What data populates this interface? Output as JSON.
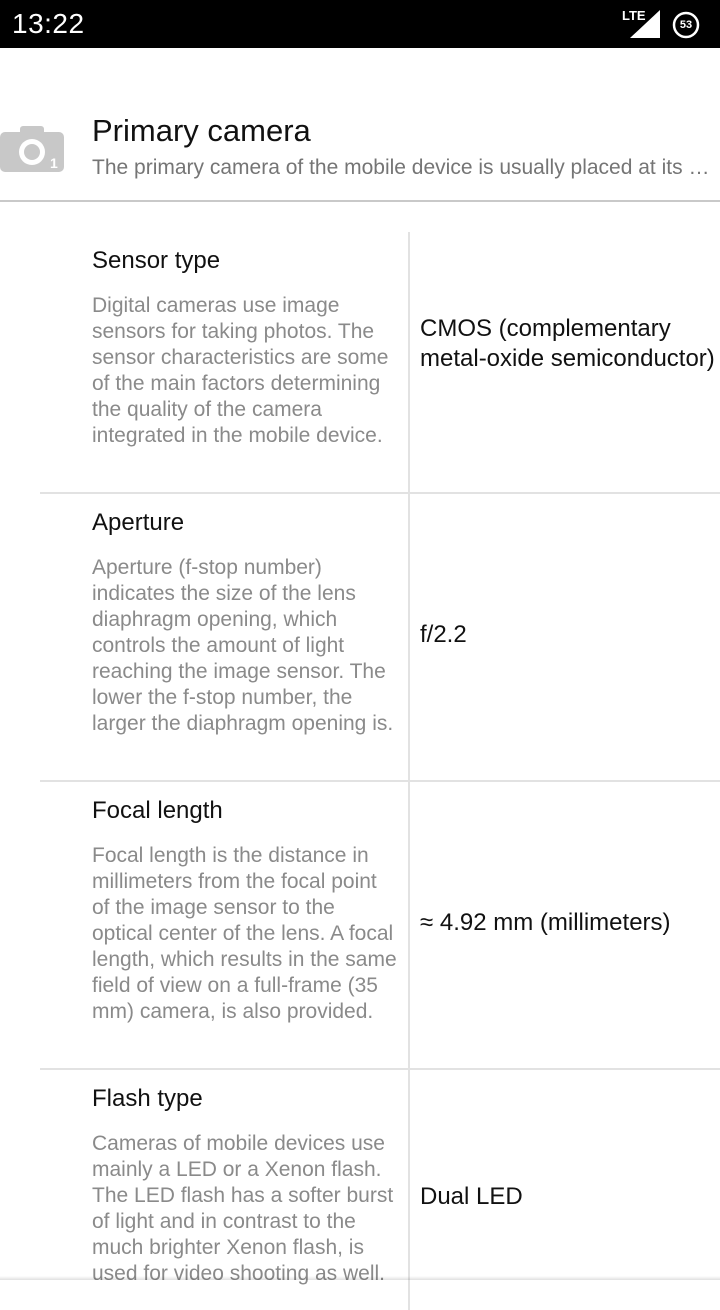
{
  "status_bar": {
    "time": "13:22",
    "network": "LTE",
    "battery": "53"
  },
  "section": {
    "icon": "camera-icon",
    "title": "Primary camera",
    "subtitle": "The primary camera of the mobile device is usually placed at its back and is used for photo and video recording."
  },
  "specs": [
    {
      "name": "Sensor type",
      "description": "Digital cameras use image sensors for taking photos. The sensor characteristics are some of the main factors determining the quality of the camera integrated in the mobile device.",
      "value": "CMOS (complementary metal-oxide semiconductor)"
    },
    {
      "name": "Aperture",
      "description": "Aperture (f-stop number) indicates the size of the lens diaphragm opening, which controls the amount of light reaching the image sensor. The lower the f-stop number, the larger the diaphragm opening is.",
      "value": "f/2.2"
    },
    {
      "name": "Focal length",
      "description": "Focal length is the distance in millimeters from the focal point of the image sensor to the optical center of the lens. A focal length, which results in the same field of view on a full-frame (35 mm) camera, is also provided.",
      "value": "≈ 4.92 mm (millimeters)"
    },
    {
      "name": "Flash type",
      "description": "Cameras of mobile devices use mainly a LED or a Xenon flash. The LED flash has a softer burst of light and in contrast to the much brighter Xenon flash, is used for video shooting as well.",
      "value": "Dual LED"
    }
  ],
  "colors": {
    "status_bar_bg": "#000000",
    "title_text": "#111111",
    "description_text": "#8a8a8a",
    "divider": "#e2e2e2"
  }
}
